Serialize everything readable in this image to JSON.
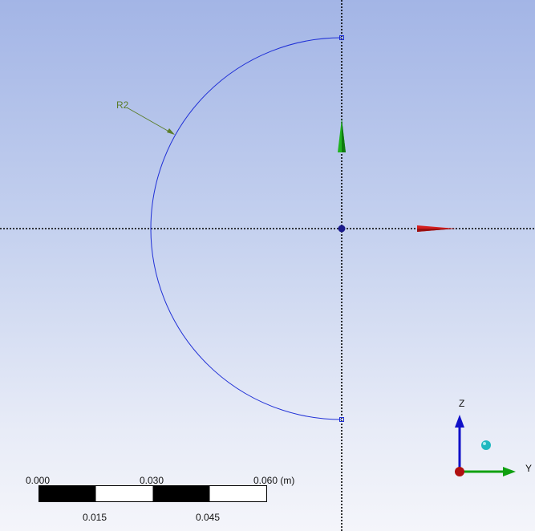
{
  "viewport": {
    "background_top": "#a3b5e6",
    "background_bottom": "#f4f5fa"
  },
  "sketch": {
    "arc_color": "#1f2fd6",
    "axis_line_color": "#000000",
    "dimension_label": "R2",
    "dimension_color": "#5b7d2a"
  },
  "triad_arrows": {
    "up_color": "#1fb21f",
    "right_color": "#d41f1f"
  },
  "scale_bar": {
    "top_labels": [
      "0.000",
      "0.030",
      "0.060 (m)"
    ],
    "bottom_labels": [
      "0.015",
      "0.045"
    ]
  },
  "orientation_triad": {
    "z_label": "Z",
    "y_label": "Y",
    "z_color": "#1010c8",
    "y_color": "#10a010",
    "origin_color": "#b01010",
    "iso_ball_color": "#20b8c0",
    "icon": "orientation-triad-icon"
  }
}
